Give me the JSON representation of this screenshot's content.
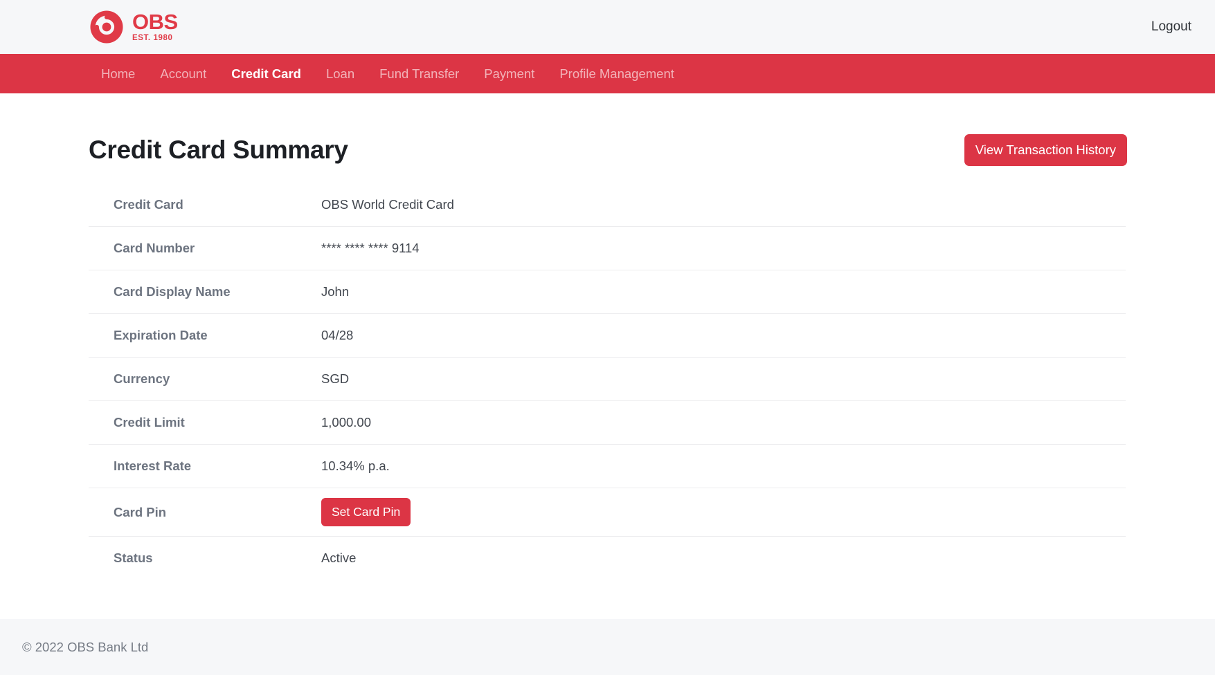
{
  "header": {
    "brand": {
      "logo_icon": "obs-swirl-logo-icon",
      "name": "OBS",
      "tagline": "EST. 1980",
      "color": "#e03a47"
    },
    "logout_label": "Logout"
  },
  "nav": {
    "accent_color": "#dc3545",
    "items": [
      {
        "label": "Home",
        "active": false
      },
      {
        "label": "Account",
        "active": false
      },
      {
        "label": "Credit Card",
        "active": true
      },
      {
        "label": "Loan",
        "active": false
      },
      {
        "label": "Fund Transfer",
        "active": false
      },
      {
        "label": "Payment",
        "active": false
      },
      {
        "label": "Profile Management",
        "active": false
      }
    ]
  },
  "main": {
    "page_title": "Credit Card Summary",
    "view_history_label": "View Transaction History",
    "set_card_pin_label": "Set Card Pin",
    "rows": [
      {
        "label": "Credit Card",
        "value": "OBS World Credit Card"
      },
      {
        "label": "Card Number",
        "value": "**** **** **** 9114"
      },
      {
        "label": "Card Display Name",
        "value": "John"
      },
      {
        "label": "Expiration Date",
        "value": "04/28"
      },
      {
        "label": "Currency",
        "value": "SGD"
      },
      {
        "label": "Credit Limit",
        "value": "1,000.00"
      },
      {
        "label": "Interest Rate",
        "value": "10.34% p.a."
      },
      {
        "label": "Card Pin",
        "value": ""
      },
      {
        "label": "Status",
        "value": "Active"
      }
    ]
  },
  "footer": {
    "copyright": "© 2022 OBS Bank Ltd"
  }
}
